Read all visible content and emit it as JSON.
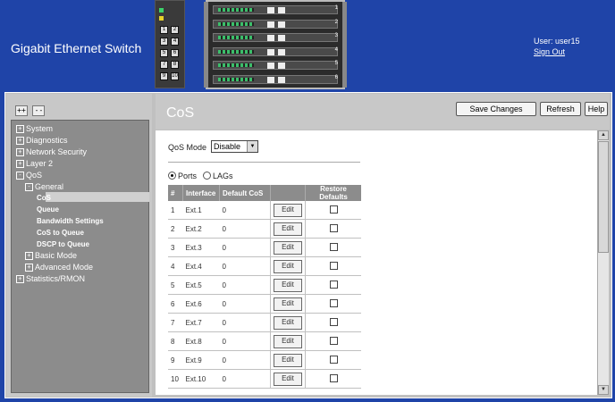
{
  "header": {
    "app_title": "Gigabit Ethernet Switch",
    "user_label": "User: user15",
    "sign_out": "Sign Out"
  },
  "switch_image": {
    "small_ports": [
      "1",
      "2",
      "3",
      "4",
      "5",
      "6",
      "7",
      "8",
      "9",
      "10"
    ],
    "blade_numbers": [
      "1",
      "2",
      "3",
      "4",
      "5",
      "6"
    ]
  },
  "tree_controls": {
    "expand_all": "++",
    "collapse_all": "--"
  },
  "sidebar": {
    "items": [
      {
        "label": "System",
        "exp": "+"
      },
      {
        "label": "Diagnostics",
        "exp": "+"
      },
      {
        "label": "Network Security",
        "exp": "+"
      },
      {
        "label": "Layer 2",
        "exp": "+"
      },
      {
        "label": "QoS",
        "exp": "-"
      },
      {
        "label": "General",
        "exp": "-"
      },
      {
        "label": "CoS",
        "exp": ""
      },
      {
        "label": "Queue",
        "exp": ""
      },
      {
        "label": "Bandwidth Settings",
        "exp": ""
      },
      {
        "label": "CoS to Queue",
        "exp": ""
      },
      {
        "label": "DSCP to Queue",
        "exp": ""
      },
      {
        "label": "Basic Mode",
        "exp": "+"
      },
      {
        "label": "Advanced Mode",
        "exp": "+"
      },
      {
        "label": "Statistics/RMON",
        "exp": "+"
      }
    ]
  },
  "content": {
    "title": "CoS",
    "buttons": {
      "save": "Save Changes",
      "refresh": "Refresh",
      "help": "Help"
    },
    "qos_mode_label": "QoS Mode",
    "qos_mode_value": "Disable",
    "radio_ports": "Ports",
    "radio_lags": "LAGs",
    "table": {
      "headers": [
        "#",
        "Interface",
        "Default CoS",
        "",
        "Restore Defaults"
      ],
      "edit_label": "Edit",
      "rows": [
        {
          "num": "1",
          "iface": "Ext.1",
          "cos": "0"
        },
        {
          "num": "2",
          "iface": "Ext.2",
          "cos": "0"
        },
        {
          "num": "3",
          "iface": "Ext.3",
          "cos": "0"
        },
        {
          "num": "4",
          "iface": "Ext.4",
          "cos": "0"
        },
        {
          "num": "5",
          "iface": "Ext.5",
          "cos": "0"
        },
        {
          "num": "6",
          "iface": "Ext.6",
          "cos": "0"
        },
        {
          "num": "7",
          "iface": "Ext.7",
          "cos": "0"
        },
        {
          "num": "8",
          "iface": "Ext.8",
          "cos": "0"
        },
        {
          "num": "9",
          "iface": "Ext.9",
          "cos": "0"
        },
        {
          "num": "10",
          "iface": "Ext.10",
          "cos": "0"
        }
      ]
    }
  },
  "colors": {
    "header_bg": "#1f44a8",
    "table_header": "#8c8c8c",
    "tree_bg": "#8c8c8c"
  }
}
